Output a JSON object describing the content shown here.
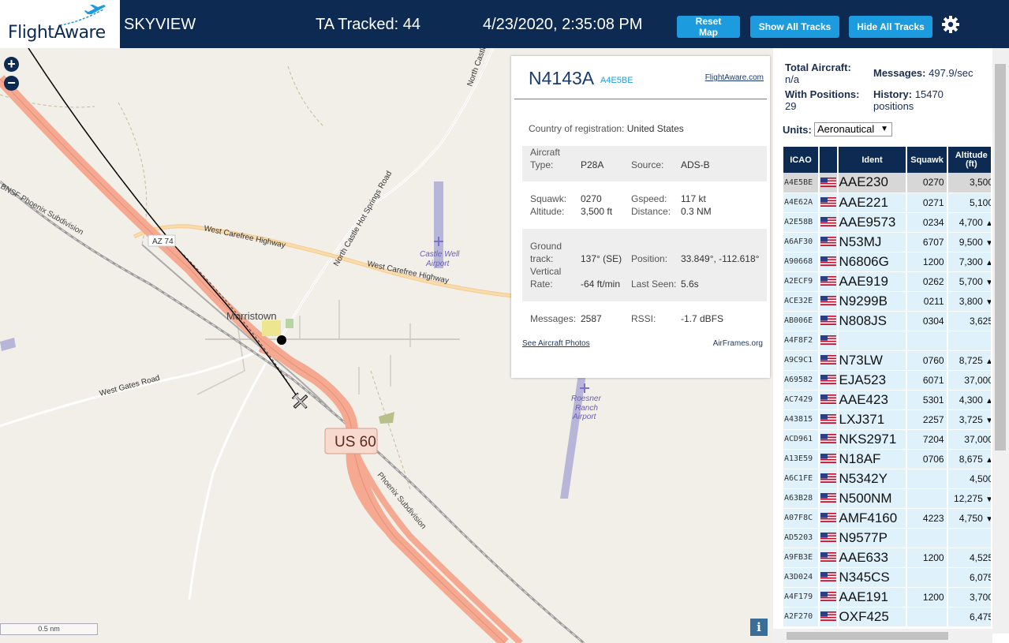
{
  "header": {
    "logo": "FlightAware",
    "app_name": "SKYVIEW",
    "tracked": "TA Tracked: 44",
    "datetime": "4/23/2020, 2:35:08 PM",
    "buttons": {
      "reset": "Reset Map",
      "show": "Show All Tracks",
      "hide": "Hide All Tracks"
    }
  },
  "map": {
    "scale": "0.5 nm",
    "info": "i",
    "labels": {
      "az74": "AZ 74",
      "west_carefree_1": "West Carefree Highway",
      "west_carefree_2": "West Carefree Highway",
      "north_castle_hot": "North Castle Hot Springs Road",
      "north_castle": "North Castle",
      "morristown": "Morristown",
      "castle_well_1": "Castle Well",
      "castle_well_2": "Airport",
      "roesner_1": "Roesner",
      "roesner_2": "Ranch",
      "roesner_3": "Airport",
      "west_gates": "West Gates Road",
      "bnsf": "BNSF Phoenix Subdivision",
      "phoenix_sub": "Phoenix Subdivision",
      "us60": "US 60"
    }
  },
  "popup": {
    "registration": "N4143A",
    "hex": "A4E5BE",
    "fa_link": "FlightAware.com",
    "country_label": "Country of registration:",
    "country": "United States",
    "aircraft_type_label_1": "Aircraft",
    "aircraft_type_label_2": "Type:",
    "aircraft_type": "P28A",
    "source_label": "Source:",
    "source": "ADS-B",
    "squawk_label": "Squawk:",
    "squawk": "0270",
    "gspeed_label": "Gspeed:",
    "gspeed": "117 kt",
    "altitude_label": "Altitude:",
    "altitude": "3,500 ft",
    "distance_label": "Distance:",
    "distance": "0.3 NM",
    "ground_label_1": "Ground",
    "ground_label_2": "track:",
    "ground_track": "137° (SE)",
    "position_label": "Position:",
    "position": "33.849°, -112.618°",
    "vertical_label_1": "Vertical",
    "vertical_label_2": "Rate:",
    "vertical_rate": "-64 ft/min",
    "last_seen_label": "Last Seen:",
    "last_seen": "5.6s",
    "messages_label": "Messages:",
    "messages": "2587",
    "rssi_label": "RSSI:",
    "rssi": "-1.7 dBFS",
    "photos_link": "See Aircraft Photos",
    "airframes_link": "AirFrames.org"
  },
  "panel": {
    "total_label": "Total Aircraft:",
    "total_value": "n/a",
    "messages_label": "Messages:",
    "messages_value": "497.9/sec",
    "with_pos_label": "With Positions:",
    "with_pos_value": "29",
    "history_label": "History:",
    "history_value": "15470",
    "history_unit": "positions",
    "units_label": "Units:",
    "units_value": "Aeronautical",
    "columns": {
      "icao": "ICAO",
      "ident": "Ident",
      "squawk": "Squawk",
      "altitude_1": "Altitude",
      "altitude_2": "(ft)"
    },
    "rows": [
      {
        "icao": "A4E5BE",
        "ident": "AAE230",
        "squawk": "0270",
        "alt": "3,500",
        "trend": ""
      },
      {
        "icao": "A4E62A",
        "ident": "AAE221",
        "squawk": "0271",
        "alt": "5,100",
        "trend": ""
      },
      {
        "icao": "A2E58B",
        "ident": "AAE9573",
        "squawk": "0234",
        "alt": "4,700",
        "trend": "▲"
      },
      {
        "icao": "A6AF30",
        "ident": "N53MJ",
        "squawk": "6707",
        "alt": "9,500",
        "trend": "▼"
      },
      {
        "icao": "A90668",
        "ident": "N6806G",
        "squawk": "1200",
        "alt": "7,300",
        "trend": "▲"
      },
      {
        "icao": "A2ECF9",
        "ident": "AAE919",
        "squawk": "0262",
        "alt": "5,700",
        "trend": "▼"
      },
      {
        "icao": "ACE32E",
        "ident": "N9299B",
        "squawk": "0211",
        "alt": "3,800",
        "trend": "▼"
      },
      {
        "icao": "AB006E",
        "ident": "N808JS",
        "squawk": "0304",
        "alt": "3,625",
        "trend": ""
      },
      {
        "icao": "A4F8F2",
        "ident": "",
        "squawk": "",
        "alt": "",
        "trend": ""
      },
      {
        "icao": "A9C9C1",
        "ident": "N73LW",
        "squawk": "0760",
        "alt": "8,725",
        "trend": "▲"
      },
      {
        "icao": "A69582",
        "ident": "EJA523",
        "squawk": "6071",
        "alt": "37,000",
        "trend": ""
      },
      {
        "icao": "AC7429",
        "ident": "AAE423",
        "squawk": "5301",
        "alt": "4,300",
        "trend": "▲"
      },
      {
        "icao": "A43815",
        "ident": "LXJ371",
        "squawk": "2257",
        "alt": "3,725",
        "trend": "▼"
      },
      {
        "icao": "ACD961",
        "ident": "NKS2971",
        "squawk": "7204",
        "alt": "37,000",
        "trend": ""
      },
      {
        "icao": "A13E59",
        "ident": "N18AF",
        "squawk": "0706",
        "alt": "8,675",
        "trend": "▲"
      },
      {
        "icao": "A6C1FE",
        "ident": "N5342Y",
        "squawk": "",
        "alt": "4,500",
        "trend": ""
      },
      {
        "icao": "A63B28",
        "ident": "N500NM",
        "squawk": "",
        "alt": "12,275",
        "trend": "▼"
      },
      {
        "icao": "A07F8C",
        "ident": "AMF4160",
        "squawk": "4223",
        "alt": "4,750",
        "trend": "▼"
      },
      {
        "icao": "AD5203",
        "ident": "N9577P",
        "squawk": "",
        "alt": "",
        "trend": ""
      },
      {
        "icao": "A9FB3E",
        "ident": "AAE633",
        "squawk": "1200",
        "alt": "4,525",
        "trend": ""
      },
      {
        "icao": "A3D024",
        "ident": "N345CS",
        "squawk": "",
        "alt": "6,075",
        "trend": ""
      },
      {
        "icao": "A4F179",
        "ident": "AAE191",
        "squawk": "1200",
        "alt": "3,700",
        "trend": ""
      },
      {
        "icao": "A2F270",
        "ident": "OXF425",
        "squawk": "",
        "alt": "6,475",
        "trend": ""
      }
    ]
  },
  "colors": {
    "header_bg": "#0d2a52",
    "button_bg": "#1c9bde",
    "row_bg": "#dff1fb",
    "highway": "#f4a990",
    "track": "#000000"
  }
}
